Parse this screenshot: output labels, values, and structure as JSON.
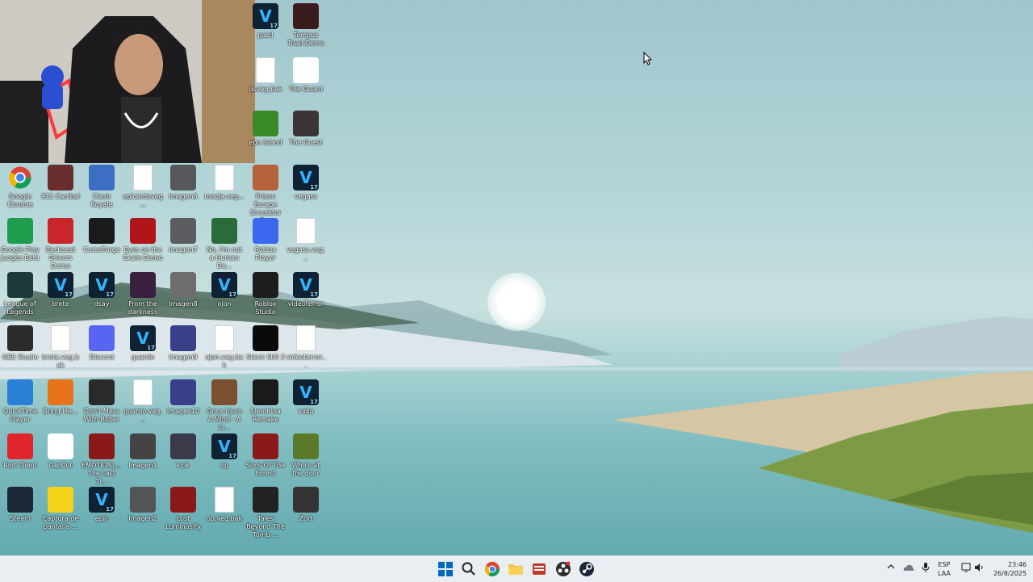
{
  "desktop_icons": [
    {
      "label": "pasd",
      "kind": "vegas"
    },
    {
      "label": "Tempus Triad Demo",
      "kind": "app",
      "color": "#3a1c1c"
    },
    {
      "label": "dsveg.bak",
      "kind": "file"
    },
    {
      "label": "The Guard",
      "kind": "app",
      "color": "#ffffff"
    },
    {
      "label": "epo Island",
      "kind": "app",
      "color": "#3a8a2a"
    },
    {
      "label": "The Guest",
      "kind": "app",
      "color": "#3b3535"
    },
    {
      "label": "Google Chrome",
      "kind": "chrome"
    },
    {
      "label": "911 Canibal",
      "kind": "app",
      "color": "#6a2e2e"
    },
    {
      "label": "Clash Royale",
      "kind": "app",
      "color": "#3c6fc4"
    },
    {
      "label": "epicardoveg...",
      "kind": "file"
    },
    {
      "label": "Imagen6",
      "kind": "app",
      "color": "#56585b"
    },
    {
      "label": "mooja.veg...",
      "kind": "file"
    },
    {
      "label": "Prison Escape Simulator D...",
      "kind": "app",
      "color": "#b5623a"
    },
    {
      "label": "vegass",
      "kind": "vegas"
    },
    {
      "label": "Google Play Juegos Beta",
      "kind": "app",
      "color": "#1e9e4c"
    },
    {
      "label": "Backseat Drivers Demo",
      "kind": "app",
      "color": "#c8262a"
    },
    {
      "label": "CurseForge",
      "kind": "app",
      "color": "#1a1a1a"
    },
    {
      "label": "Eyes on the Exam Demo",
      "kind": "app",
      "color": "#b1151b"
    },
    {
      "label": "Imagen7",
      "kind": "app",
      "color": "#5b5d60"
    },
    {
      "label": "No, I'm not a Human De...",
      "kind": "app",
      "color": "#2b6b3a"
    },
    {
      "label": "Roblox Player",
      "kind": "app",
      "color": "#3c68f0"
    },
    {
      "label": "vegass.veg...",
      "kind": "file"
    },
    {
      "label": "League of Legends",
      "kind": "app",
      "color": "#1d3a3a"
    },
    {
      "label": "brete",
      "kind": "vegas"
    },
    {
      "label": "dsay",
      "kind": "vegas"
    },
    {
      "label": "From the darkness",
      "kind": "app",
      "color": "#3a1f3f"
    },
    {
      "label": "Imagen8",
      "kind": "app",
      "color": "#6d6d6d"
    },
    {
      "label": "ojon",
      "kind": "vegas"
    },
    {
      "label": "Roblox Studio",
      "kind": "app",
      "color": "#1d1d1d"
    },
    {
      "label": "videoterror",
      "kind": "vegas"
    },
    {
      "label": "OBS Studio",
      "kind": "app",
      "color": "#2b2b2b"
    },
    {
      "label": "brete.veg.bak",
      "kind": "file"
    },
    {
      "label": "Discord",
      "kind": "app",
      "color": "#5865f2"
    },
    {
      "label": "guardo",
      "kind": "vegas"
    },
    {
      "label": "Imagen9",
      "kind": "app",
      "color": "#3a3f8a"
    },
    {
      "label": "ojon.veg.bak",
      "kind": "file"
    },
    {
      "label": "Silent Still 2",
      "kind": "app",
      "color": "#0a0a0a"
    },
    {
      "label": "videoterror...",
      "kind": "file"
    },
    {
      "label": "QuickTime Player",
      "kind": "app",
      "color": "#2a7fd6"
    },
    {
      "label": "Bring Me...",
      "kind": "app",
      "color": "#e8731a"
    },
    {
      "label": "Don't Mess With Bober",
      "kind": "app",
      "color": "#2a2a2a"
    },
    {
      "label": "guardo.veg...",
      "kind": "file"
    },
    {
      "label": "Imagen10",
      "kind": "app",
      "color": "#3a3f8a"
    },
    {
      "label": "Once Upon A Mind - A Li...",
      "kind": "app",
      "color": "#7a5030"
    },
    {
      "label": "Slendrina Remake",
      "kind": "app",
      "color": "#1a1a1a"
    },
    {
      "label": "vidio",
      "kind": "vegas"
    },
    {
      "label": "Riot Client",
      "kind": "app",
      "color": "#e0252c"
    },
    {
      "label": "CapCut",
      "kind": "app",
      "color": "#ffffff"
    },
    {
      "label": "EMOTIONL... The Last Ti...",
      "kind": "app",
      "color": "#8a1a1a"
    },
    {
      "label": "Imagen1",
      "kind": "app",
      "color": "#444444"
    },
    {
      "label": "kcik",
      "kind": "app",
      "color": "#3a3a4a"
    },
    {
      "label": "op",
      "kind": "vegas"
    },
    {
      "label": "Sons Of The Forest",
      "kind": "app",
      "color": "#8a1a1a"
    },
    {
      "label": "Who's at the door",
      "kind": "app",
      "color": "#5a7a2a"
    },
    {
      "label": "Steam",
      "kind": "app",
      "color": "#1b2838"
    },
    {
      "label": "Captura de pantalla ...",
      "kind": "app",
      "color": "#f4d21a"
    },
    {
      "label": "epic",
      "kind": "vegas"
    },
    {
      "label": "Imagen2",
      "kind": "app",
      "color": "#555555"
    },
    {
      "label": "Lost Luminosity",
      "kind": "app",
      "color": "#8a1a1a"
    },
    {
      "label": "op.veg.bak",
      "kind": "file"
    },
    {
      "label": "Tales Beyond The Tomb ...",
      "kind": "app",
      "color": "#222222"
    },
    {
      "label": "Zort",
      "kind": "app",
      "color": "#333333"
    }
  ],
  "taskbar": {
    "apps": [
      {
        "name": "windows-start-button"
      },
      {
        "name": "search-button"
      },
      {
        "name": "chrome-taskbar"
      },
      {
        "name": "file-explorer-taskbar"
      },
      {
        "name": "media-app-taskbar"
      },
      {
        "name": "obs-taskbar"
      },
      {
        "name": "steam-taskbar"
      }
    ],
    "language_top": "ESP",
    "language_bottom": "LAA",
    "time": "23:46",
    "date": "26/8/2025"
  },
  "colors": {
    "accent": "#0067c0",
    "taskbar_bg": "#e9eef3"
  }
}
